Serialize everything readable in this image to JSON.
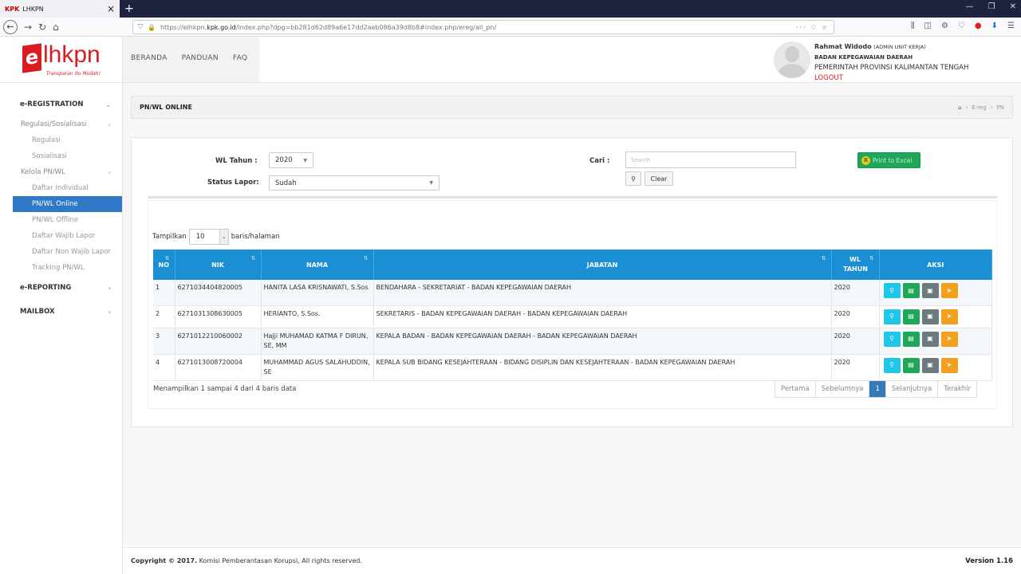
{
  "browser": {
    "tab_title": "LHKPN",
    "tab_fav": "KPK",
    "url_prefix": "https://elhkpn.",
    "url_domain": "kpk.go.id",
    "url_rest": "/index.php?dpg=bb281d62d89a6e17dd2aeb086a39d8b8#index.php/ereg/all_pn/",
    "url_actions": "··· ♡ ☆"
  },
  "header": {
    "logo_e": "e",
    "logo_text": "lhkpn",
    "logo_tagline": "Transparan itu Mudah!",
    "menu": [
      "BERANDA",
      "PANDUAN",
      "FAQ"
    ],
    "user_name": "Rahmat Widodo",
    "user_role": "(ADMIN UNIT KERJA)",
    "user_dept": "BADAN KEPEGAWAIAN DAERAH",
    "user_prov": "PEMERINTAH PROVINSI KALIMANTAN TENGAH",
    "logout": "LOGOUT"
  },
  "sidebar": {
    "ereg": "e-REGISTRATION",
    "regulasi": "Regulasi/Sosialisasi",
    "items_reg": [
      "Regulasi",
      "Sosialisasi"
    ],
    "kelola": "Kelola PN/WL",
    "items_kelola": [
      "Daftar Individual",
      "PN/WL Online",
      "PN/WL Offline",
      "Daftar Wajib Lapor",
      "Daftar Non Wajib Lapor",
      "Tracking PN/WL"
    ],
    "ereporting": "e-REPORTING",
    "mailbox": "MAILBOX"
  },
  "page": {
    "title": "PN/WL ONLINE",
    "crumb": [
      "E-reg",
      "PN"
    ]
  },
  "filters": {
    "wl_tahun_label": "WL Tahun :",
    "wl_tahun_value": "2020",
    "status_label": "Status Lapor:",
    "status_value": "Sudah",
    "cari_label": "Cari :",
    "search_placeholder": "Search",
    "clear_label": "Clear",
    "excel_label": "Print to Excel"
  },
  "table": {
    "show_prefix": "Tampilkan",
    "show_value": "10",
    "show_suffix": "baris/halaman",
    "headers": [
      "NO",
      "NIK",
      "NAMA",
      "JABATAN",
      "WL TAHUN",
      "AKSI"
    ],
    "rows": [
      {
        "no": "1",
        "nik": "6271034404820005",
        "nama": "HANITA LASA KRISNAWATI, S.Sos",
        "jabatan": "BENDAHARA - SEKRETARIAT - BADAN KEPEGAWAIAN DAERAH",
        "tahun": "2020"
      },
      {
        "no": "2",
        "nik": "6271031308630005",
        "nama": "HERIANTO, S.Sos.",
        "jabatan": "SEKRETARIS - BADAN KEPEGAWAIAN DAERAH - BADAN KEPEGAWAIAN DAERAH",
        "tahun": "2020"
      },
      {
        "no": "3",
        "nik": "6271012210060002",
        "nama": "Hajji MUHAMAD KATMA F DIRUN, SE, MM",
        "jabatan": "KEPALA BADAN - BADAN KEPEGAWAIAN DAERAH - BADAN KEPEGAWAIAN DAERAH",
        "tahun": "2020"
      },
      {
        "no": "4",
        "nik": "6271013008720004",
        "nama": "MUHAMMAD AGUS SALAHUDDIN, SE",
        "jabatan": "KEPALA SUB BIDANG KESEJAHTERAAN - BIDANG DISIPLIN DAN KESEJAHTERAAN - BADAN KEPEGAWAIAN DAERAH",
        "tahun": "2020"
      }
    ],
    "info": "Menampilkan 1 sampai 4 dari 4 baris data",
    "pager": [
      "Pertama",
      "Sebelumnya",
      "1",
      "Selanjutnya",
      "Terakhir"
    ]
  },
  "footer": {
    "copyright_bold": "Copyright © 2017.",
    "copyright_rest": "Komisi Pemberantasan Korupsi, All rights reserved.",
    "version": "Version 1.16"
  }
}
